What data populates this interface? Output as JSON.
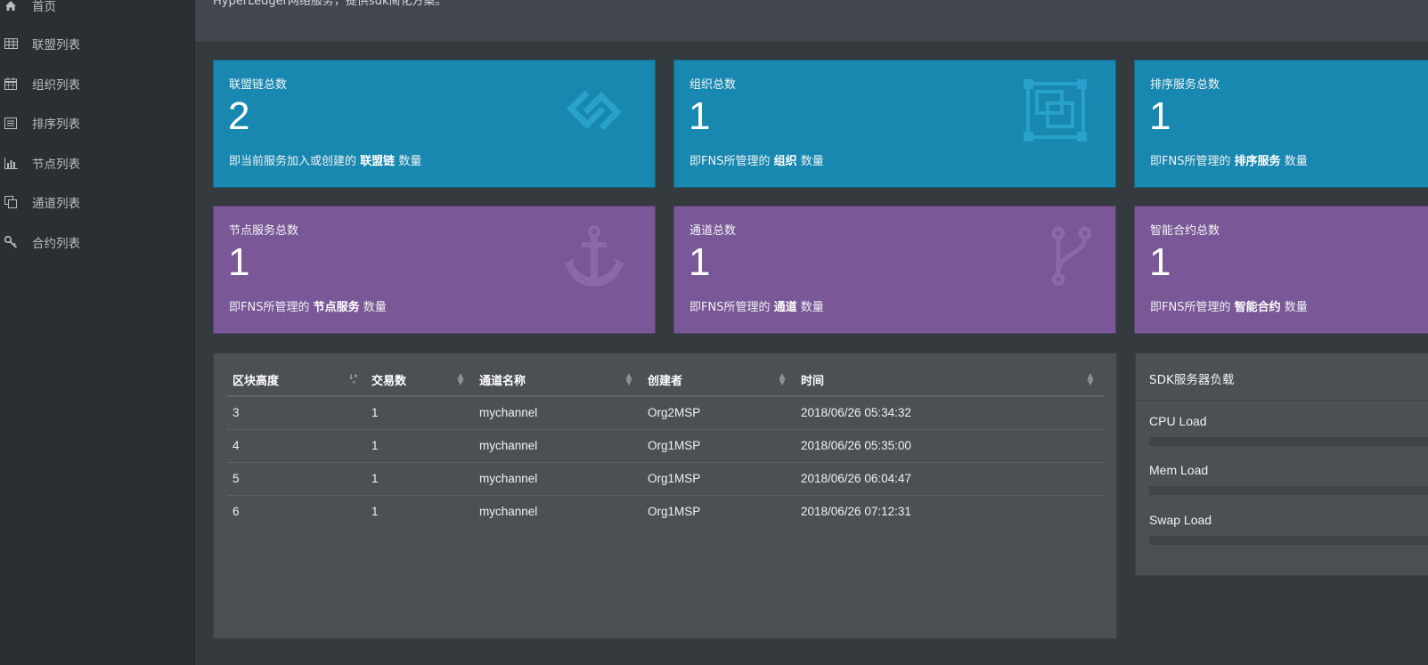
{
  "header": {
    "subtitle": "HyperLedger网络服务，提供sdk简化方案。"
  },
  "sidebar": {
    "items": [
      {
        "label": "首页",
        "icon": "home-icon"
      },
      {
        "label": "联盟列表",
        "icon": "table-icon"
      },
      {
        "label": "组织列表",
        "icon": "calendar-icon"
      },
      {
        "label": "排序列表",
        "icon": "list-icon"
      },
      {
        "label": "节点列表",
        "icon": "bar-chart-icon"
      },
      {
        "label": "通道列表",
        "icon": "copy-icon"
      },
      {
        "label": "合约列表",
        "icon": "key-icon"
      }
    ]
  },
  "cards": [
    {
      "title": "联盟链总数",
      "value": "2",
      "desc_prefix": "即当前服务加入或创建的",
      "desc_bold": "联盟链",
      "desc_suffix": "数量",
      "icon": "chain-link-icon",
      "color": "#1888b0"
    },
    {
      "title": "组织总数",
      "value": "1",
      "desc_prefix": "即FNS所管理的",
      "desc_bold": "组织",
      "desc_suffix": "数量",
      "icon": "object-group-icon",
      "color": "#1888b0"
    },
    {
      "title": "排序服务总数",
      "value": "1",
      "desc_prefix": "即FNS所管理的",
      "desc_bold": "排序服务",
      "desc_suffix": "数量",
      "icon": "sort-service-icon",
      "color": "#1888b0"
    },
    {
      "title": "节点服务总数",
      "value": "1",
      "desc_prefix": "即FNS所管理的",
      "desc_bold": "节点服务",
      "desc_suffix": "数量",
      "icon": "anchor-icon",
      "color": "#7a5796"
    },
    {
      "title": "通道总数",
      "value": "1",
      "desc_prefix": "即FNS所管理的",
      "desc_bold": "通道",
      "desc_suffix": "数量",
      "icon": "code-fork-icon",
      "color": "#7a5796"
    },
    {
      "title": "智能合约总数",
      "value": "1",
      "desc_prefix": "即FNS所管理的",
      "desc_bold": "智能合约",
      "desc_suffix": "数量",
      "icon": "contract-icon",
      "color": "#7a5796"
    }
  ],
  "blocks_table": {
    "columns": [
      "区块高度",
      "交易数",
      "通道名称",
      "创建者",
      "时间"
    ],
    "rows": [
      [
        "3",
        "1",
        "mychannel",
        "Org2MSP",
        "2018/06/26 05:34:32"
      ],
      [
        "4",
        "1",
        "mychannel",
        "Org1MSP",
        "2018/06/26 05:35:00"
      ],
      [
        "5",
        "1",
        "mychannel",
        "Org1MSP",
        "2018/06/26 06:04:47"
      ],
      [
        "6",
        "1",
        "mychannel",
        "Org1MSP",
        "2018/06/26 07:12:31"
      ]
    ]
  },
  "sdk_load": {
    "title": "SDK服务器负载",
    "items": [
      {
        "label": "CPU Load",
        "level": 0
      },
      {
        "label": "Mem Load",
        "level": 0
      },
      {
        "label": "Swap Load",
        "level": 0
      }
    ]
  }
}
